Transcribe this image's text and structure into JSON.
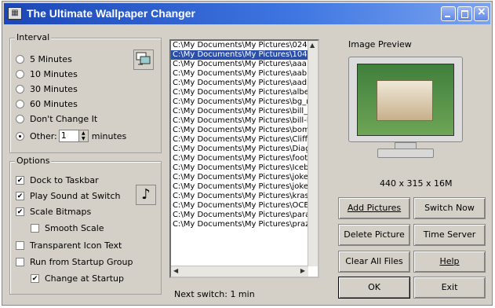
{
  "window": {
    "title": "The Ultimate Wallpaper Changer"
  },
  "interval": {
    "legend": "Interval",
    "options": [
      "5 Minutes",
      "10 Minutes",
      "30 Minutes",
      "60 Minutes",
      "Don't Change It"
    ],
    "other_label": "Other:",
    "other_value": "1",
    "other_unit": "minutes",
    "selected": "Other:"
  },
  "options": {
    "legend": "Options",
    "dock_to_taskbar": {
      "label": "Dock to Taskbar",
      "checked": true
    },
    "play_sound": {
      "label": "Play Sound at Switch",
      "checked": true
    },
    "scale_bitmaps": {
      "label": "Scale Bitmaps",
      "checked": true
    },
    "smooth_scale": {
      "label": "Smooth Scale",
      "checked": false
    },
    "transparent_icon_text": {
      "label": "Transparent Icon Text",
      "checked": false
    },
    "run_from_startup": {
      "label": "Run from Startup Group",
      "checked": false
    },
    "change_at_startup": {
      "label": "Change at Startup",
      "checked": true
    }
  },
  "file_list": [
    "C:\\My Documents\\My Pictures\\024.jpg",
    "C:\\My Documents\\My Pictures\\1048",
    "C:\\My Documents\\My Pictures\\aaa.j",
    "C:\\My Documents\\My Pictures\\aab.j",
    "C:\\My Documents\\My Pictures\\aad.j",
    "C:\\My Documents\\My Pictures\\albet",
    "C:\\My Documents\\My Pictures\\bg_n",
    "C:\\My Documents\\My Pictures\\bill_c",
    "C:\\My Documents\\My Pictures\\bill-h",
    "C:\\My Documents\\My Pictures\\bomb",
    "C:\\My Documents\\My Pictures\\Cliff i",
    "C:\\My Documents\\My Pictures\\Diag",
    "C:\\My Documents\\My Pictures\\footp",
    "C:\\My Documents\\My Pictures\\Icebo",
    "C:\\My Documents\\My Pictures\\joke_",
    "C:\\My Documents\\My Pictures\\joke_",
    "C:\\My Documents\\My Pictures\\krasr",
    "C:\\My Documents\\My Pictures\\OCEA",
    "C:\\My Documents\\My Pictures\\para",
    "C:\\My Documents\\My Pictures\\praz"
  ],
  "selected_index": 1,
  "preview": {
    "label": "Image Preview",
    "resolution": "440 x 315 x 16M"
  },
  "buttons": {
    "add_pictures": "Add Pictures",
    "switch_now": "Switch Now",
    "delete_picture": "Delete Picture",
    "time_server": "Time Server",
    "clear_all_files": "Clear All Files",
    "help": "Help",
    "ok": "OK",
    "exit": "Exit"
  },
  "status": {
    "next_switch": "Next switch: 1 min"
  },
  "icons": {
    "app": "wallpaper-app-icon",
    "interval_icon": "wallpaper-cycle-icon",
    "sound_icon": "music-note-icon"
  }
}
